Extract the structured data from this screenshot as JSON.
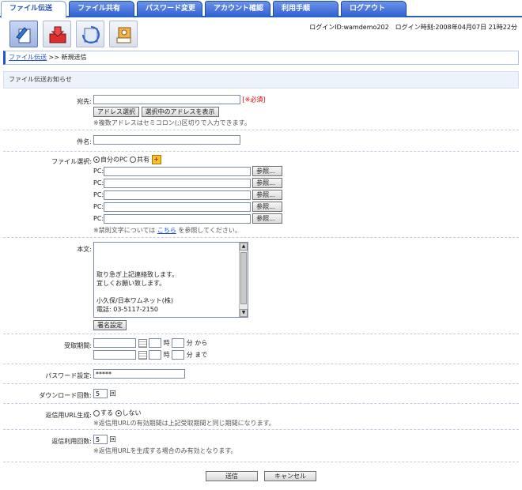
{
  "tabs": [
    {
      "label": "ファイル伝送"
    },
    {
      "label": "ファイル共有"
    },
    {
      "label": "パスワード変更"
    },
    {
      "label": "アカウント確認"
    },
    {
      "label": "利用手順"
    },
    {
      "label": "ログアウト"
    }
  ],
  "toolbar": {
    "icons": [
      "send-file-icon",
      "inbox-download-icon",
      "history-icon",
      "address-book-icon"
    ],
    "login_info": "ログインID:wamdemo202　ログイン時刻:2008年04月07日 21時22分"
  },
  "breadcrumb": {
    "link": "ファイル伝送",
    "separator": ">>",
    "current": "新規送信"
  },
  "notice": "ファイル伝送お知らせ",
  "form": {
    "recipient": {
      "label": "宛先:",
      "required": "[※必須]",
      "address_select": "アドレス選択",
      "show_selected": "選択中のアドレスを表示",
      "note": "※複数アドレスはセミコロン(;)区切りで入力できます。"
    },
    "subject": {
      "label": "件名:"
    },
    "file": {
      "label": "ファイル選択:",
      "source_pc": "自分のPC",
      "source_shared": "共有",
      "pc_prefix": "PC:",
      "browse": "参照...",
      "note_before": "※禁則文字については",
      "note_link": "こちら",
      "note_after": "を参照してください。"
    },
    "body": {
      "label": "本文:",
      "text_lines": [
        "",
        "",
        "",
        "取り急ぎ上記連絡致します。",
        "宜しくお願い致します。",
        "",
        "小久保/日本ワムネット(株)",
        "電話: 03-5117-2150"
      ],
      "signature_button": "署名設定"
    },
    "period": {
      "label": "受取期間:",
      "hour": "時",
      "from": "分 から",
      "to": "分 まで"
    },
    "password": {
      "label": "パスワード設定:",
      "value": "*****"
    },
    "download_count": {
      "label": "ダウンロード回数:",
      "value": "5",
      "unit": "回"
    },
    "return_url": {
      "label": "返信用URL生成:",
      "yes": "する",
      "no": "しない",
      "note": "※返信用URLの有効期間は上記受取期間と同じ期間になります。"
    },
    "return_count": {
      "label": "返信利用回数:",
      "value": "5",
      "unit": "回",
      "note": "※返信用URLを生成する場合のみ有効となります。"
    }
  },
  "actions": {
    "send": "送信",
    "cancel": "キャンセル"
  }
}
